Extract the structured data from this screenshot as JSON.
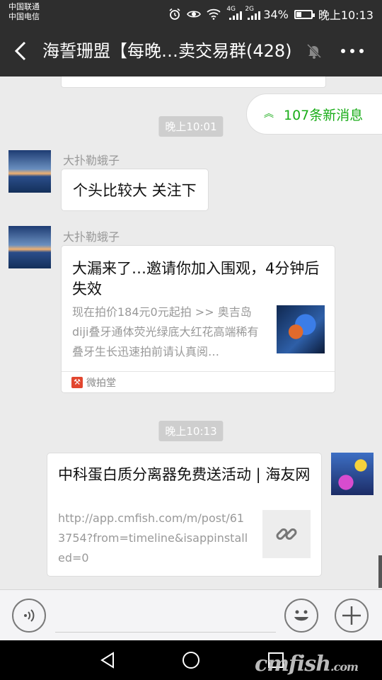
{
  "status_bar": {
    "carrier_1": "中国联通",
    "carrier_2": "中国电信",
    "net_1": "4G",
    "net_2": "2G",
    "battery": "34%",
    "battery_level": 0.34,
    "time": "晚上10:13"
  },
  "header": {
    "title": "海誓珊盟【每晚…卖交易群(428)"
  },
  "new_messages_banner": "107条新消息",
  "messages": [
    {
      "type": "time",
      "text": "晚上10:01"
    },
    {
      "type": "text",
      "sender": "大扑勒蛾子",
      "text": "个头比较大 关注下"
    },
    {
      "type": "card",
      "sender": "大扑勒蛾子",
      "title": "大漏来了…邀请你加入围观，4分钟后失效",
      "description": "现在拍价184元0元起拍 >> 奥吉岛diji叠牙通体荧光绿底大红花高端稀有叠牙生长迅速拍前请认真阅…",
      "source": "微拍堂"
    },
    {
      "type": "time",
      "text": "晚上10:13"
    },
    {
      "type": "link",
      "title": "中科蛋白质分离器免费送活动 | 海友网",
      "url": "http://app.cmfish.com/m/post/613754?from=timeline&isappinstalled=0"
    }
  ],
  "watermark": "cmfish",
  "watermark_suffix": ".com",
  "colors": {
    "bar_bg": "#2e2e2e",
    "chat_bg": "#ebebeb",
    "accent_green": "#1aad19"
  }
}
